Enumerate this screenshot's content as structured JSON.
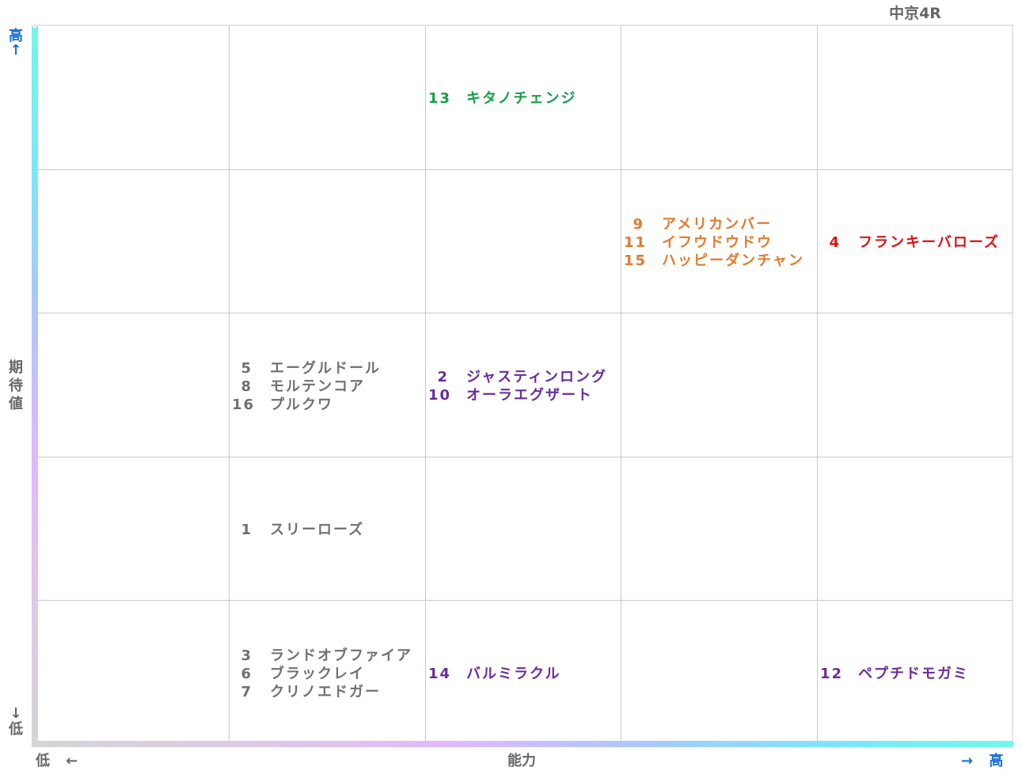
{
  "title": "中京4R",
  "axes": {
    "y_label": "期待値",
    "x_label": "能力",
    "y_high_label": "高",
    "y_high_arrow": "↑",
    "y_low_arrow": "↓",
    "y_low_label": "低",
    "x_low_label": "低",
    "x_low_arrow": "←",
    "x_high_arrow": "→",
    "x_high_label": "高"
  },
  "colors": {
    "green": "#13a046",
    "orange": "#e07b2d",
    "red": "#e01010",
    "purple": "#6a2c9e",
    "gray": "#707070",
    "grid": "#c9c9c9",
    "arrow_blue": "#1a6fd1"
  },
  "chart_data": {
    "type": "table",
    "columns": 5,
    "rows": 5,
    "cells": [
      {
        "row": 0,
        "col": 2,
        "color": "green",
        "items": [
          {
            "num": "13",
            "name": "キタノチェンジ"
          }
        ]
      },
      {
        "row": 1,
        "col": 3,
        "color": "orange",
        "items": [
          {
            "num": "9",
            "name": "アメリカンバー"
          },
          {
            "num": "11",
            "name": "イフウドウドウ"
          },
          {
            "num": "15",
            "name": "ハッピーダンチャン"
          }
        ]
      },
      {
        "row": 1,
        "col": 4,
        "color": "red",
        "items": [
          {
            "num": "4",
            "name": "フランキーバローズ"
          }
        ]
      },
      {
        "row": 2,
        "col": 1,
        "color": "gray",
        "items": [
          {
            "num": "5",
            "name": "エーグルドール"
          },
          {
            "num": "8",
            "name": "モルテンコア"
          },
          {
            "num": "16",
            "name": "プルクワ"
          }
        ]
      },
      {
        "row": 2,
        "col": 2,
        "color": "purple",
        "items": [
          {
            "num": "2",
            "name": "ジャスティンロング"
          },
          {
            "num": "10",
            "name": "オーラエグザート"
          }
        ]
      },
      {
        "row": 3,
        "col": 1,
        "color": "gray",
        "items": [
          {
            "num": "1",
            "name": "スリーローズ"
          }
        ]
      },
      {
        "row": 4,
        "col": 1,
        "color": "gray",
        "items": [
          {
            "num": "3",
            "name": "ランドオブファイア"
          },
          {
            "num": "6",
            "name": "ブラックレイ"
          },
          {
            "num": "7",
            "name": "クリノエドガー"
          }
        ]
      },
      {
        "row": 4,
        "col": 2,
        "color": "purple",
        "items": [
          {
            "num": "14",
            "name": "バルミラクル"
          }
        ]
      },
      {
        "row": 4,
        "col": 4,
        "color": "purple",
        "items": [
          {
            "num": "12",
            "name": "ペプチドモガミ"
          }
        ]
      }
    ]
  }
}
